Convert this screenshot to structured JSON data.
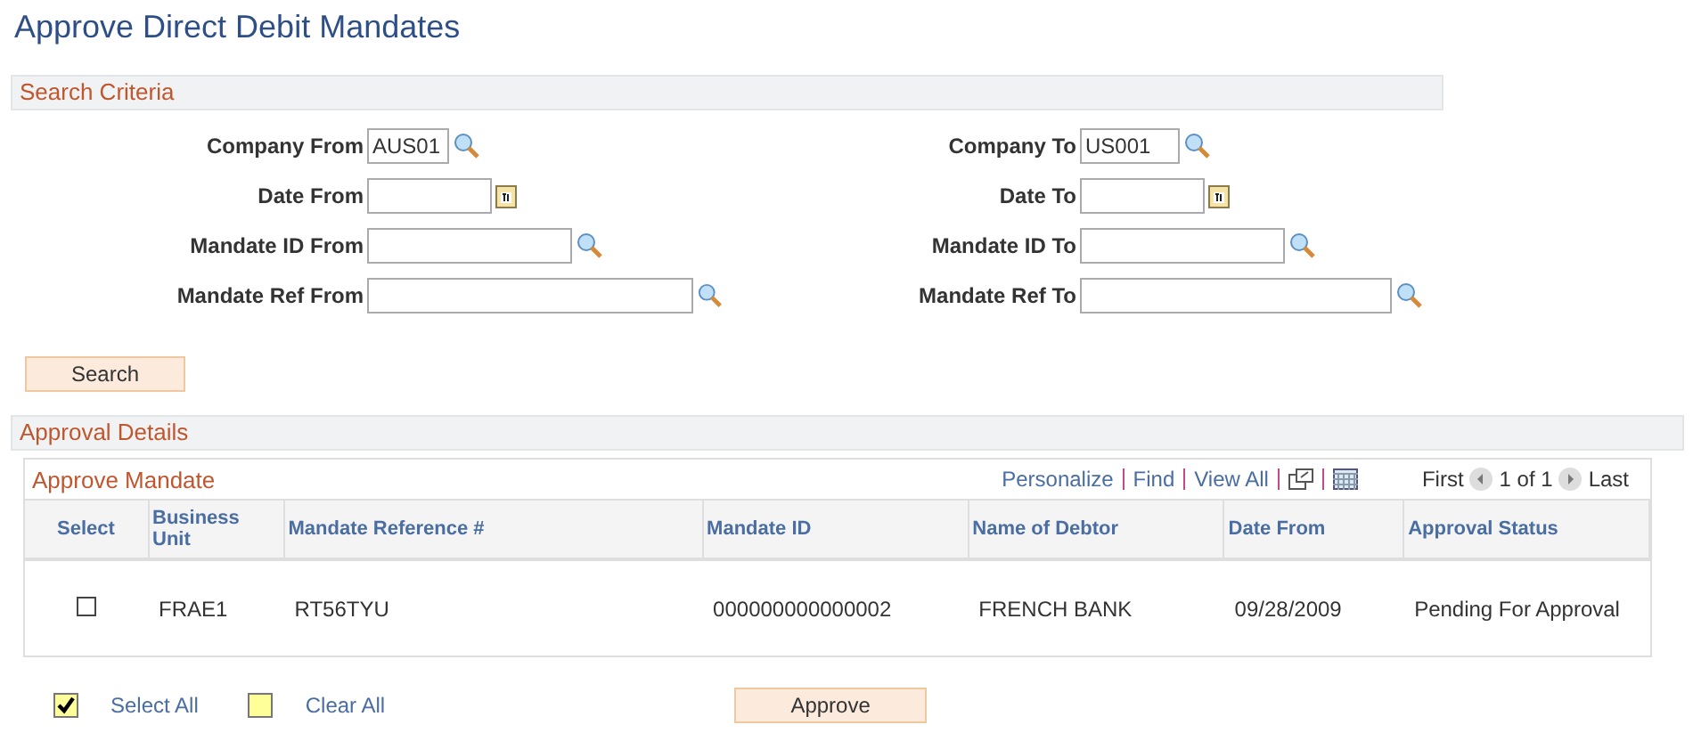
{
  "title": "Approve Direct Debit Mandates",
  "search_criteria": {
    "heading": "Search Criteria",
    "rows": [
      {
        "from": {
          "label": "Company From",
          "value": "AUS01",
          "kind": "lookup"
        },
        "to": {
          "label": "Company To",
          "value": "US001",
          "kind": "lookup"
        }
      },
      {
        "from": {
          "label": "Date From",
          "kind": "date"
        },
        "to": {
          "label": "Date To",
          "kind": "date"
        }
      },
      {
        "from": {
          "label": "Mandate ID From",
          "kind": "lookup"
        },
        "to": {
          "label": "Mandate ID To",
          "kind": "lookup"
        }
      },
      {
        "from": {
          "label": "Mandate Ref From",
          "kind": "lookup"
        },
        "to": {
          "label": "Mandate Ref To",
          "kind": "lookup"
        }
      }
    ],
    "search_button": "Search"
  },
  "approval_details": {
    "heading": "Approval Details",
    "grid": {
      "title": "Approve Mandate",
      "links": [
        "Personalize",
        "Find",
        "View All"
      ],
      "pager": {
        "first": "First",
        "count": "1 of 1",
        "last": "Last"
      },
      "select_column": "Select",
      "columns": [
        "Business Unit",
        "Mandate Reference #",
        "Mandate ID",
        "Name of Debtor",
        "Date From",
        "Approval Status"
      ],
      "rows": [
        {
          "selected": false,
          "cells": [
            "FRAE1",
            "RT56TYU",
            "000000000000002",
            "FRENCH BANK",
            "09/28/2009",
            "Pending For Approval"
          ]
        }
      ]
    },
    "select_all": {
      "label": "Select All",
      "checked": true
    },
    "clear_all": {
      "label": "Clear All",
      "checked": false
    },
    "approve_button": "Approve"
  }
}
